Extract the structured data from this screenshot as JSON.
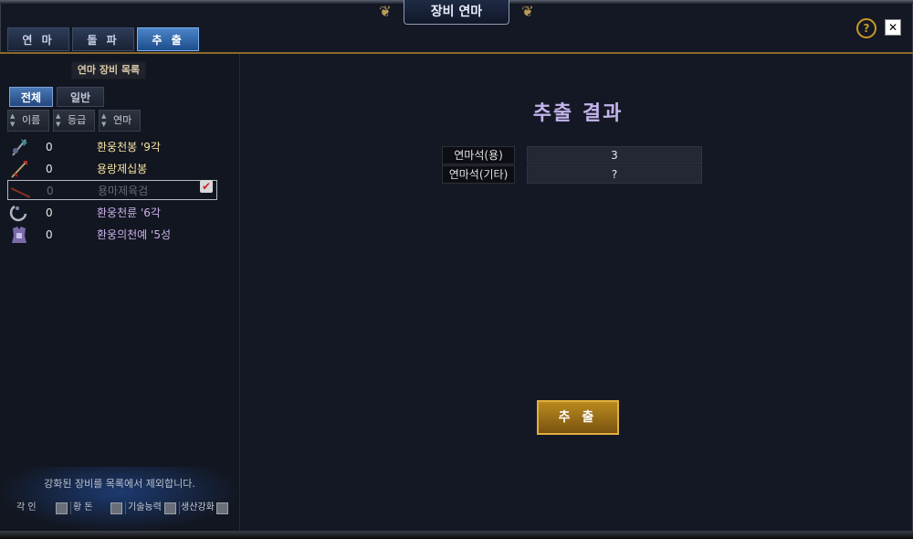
{
  "window": {
    "title": "장비 연마",
    "help_label": "?",
    "close_label": "✕"
  },
  "tabs": [
    {
      "label": "연 마",
      "active": false
    },
    {
      "label": "돌 파",
      "active": false
    },
    {
      "label": "추 출",
      "active": true
    }
  ],
  "left": {
    "list_title": "연마 장비 목록",
    "filters": {
      "all": "전체",
      "normal": "일반"
    },
    "sort": {
      "name": "이름",
      "grade": "등급",
      "polish": "연마"
    },
    "items": [
      {
        "count": "0",
        "name": "환웅천봉 '9각",
        "icon": "halberd-icon",
        "selected": false
      },
      {
        "count": "0",
        "name": "용랑제십봉",
        "icon": "spear-icon",
        "selected": false
      },
      {
        "count": "0",
        "name": "용마제육검",
        "icon": "sword-icon",
        "selected": true
      },
      {
        "count": "0",
        "name": "환웅천륜 '6각",
        "icon": "ring-blade-icon",
        "selected": false
      },
      {
        "count": "0",
        "name": "환웅의천예 '5성",
        "icon": "armor-icon",
        "selected": false
      }
    ],
    "note": "강화된 장비를 목록에서 제외합니다.",
    "exclusions": [
      "각 인",
      "황 돈",
      "기술능력",
      "생산강화"
    ]
  },
  "result": {
    "title": "추출 결과",
    "rows": [
      {
        "label": "연마석(용)",
        "value": "3"
      },
      {
        "label": "연마석(기타)",
        "value": "?"
      }
    ],
    "extract_button": "추 출"
  },
  "colors": {
    "gold": "#c89a28",
    "accent_blue": "#4a84c8",
    "item_gold": "#f4e3a0",
    "item_purple": "#c9b0e8",
    "result_title": "#c4b4ec"
  }
}
